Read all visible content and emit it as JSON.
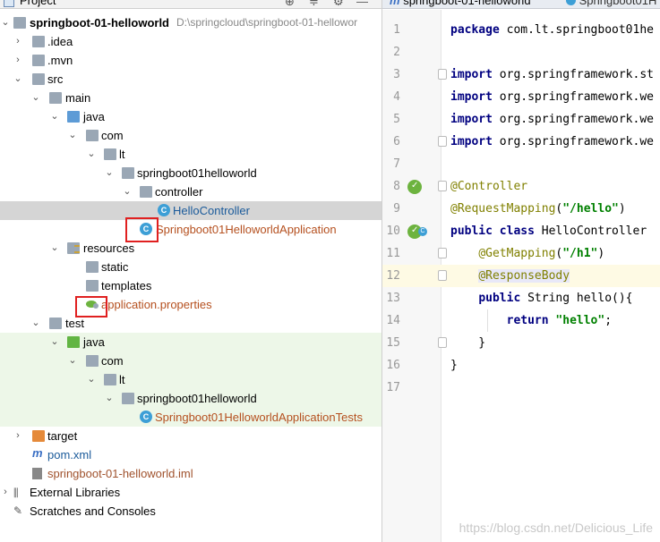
{
  "project_panel": {
    "title": "Project",
    "root": {
      "name": "springboot-01-helloworld",
      "path": "D:\\springcloud\\springboot-01-hellowor"
    },
    "nodes": {
      "idea": ".idea",
      "mvn": ".mvn",
      "src": "src",
      "main": "main",
      "java": "java",
      "com": "com",
      "lt": "lt",
      "pkg": "springboot01helloworld",
      "controller": "controller",
      "hello_controller": "HelloController",
      "app": "Springboot01HelloworldApplication",
      "resources": "resources",
      "static": "static",
      "templates": "templates",
      "app_props": "application.properties",
      "test": "test",
      "test_java": "java",
      "test_com": "com",
      "test_lt": "lt",
      "test_pkg": "springboot01helloworld",
      "app_tests": "Springboot01HelloworldApplicationTests",
      "target": "target",
      "pom": "pom.xml",
      "iml": "springboot-01-helloworld.iml",
      "ext_libs": "External Libraries",
      "scratches": "Scratches and Consoles"
    }
  },
  "editor": {
    "tabs": [
      {
        "label": "springboot-01-helloworld",
        "prefix": "m"
      },
      {
        "label": "Springboot01H"
      }
    ],
    "current_line": 12,
    "lines": [
      {
        "n": "1",
        "segs": [
          [
            "kw",
            "package "
          ],
          [
            "",
            "com.lt.springboot01he"
          ]
        ]
      },
      {
        "n": "2",
        "segs": []
      },
      {
        "n": "3",
        "segs": [
          [
            "kw",
            "import "
          ],
          [
            "",
            "org.springframework.st"
          ]
        ]
      },
      {
        "n": "4",
        "segs": [
          [
            "kw",
            "import "
          ],
          [
            "",
            "org.springframework.we"
          ]
        ]
      },
      {
        "n": "5",
        "segs": [
          [
            "kw",
            "import "
          ],
          [
            "",
            "org.springframework.we"
          ]
        ]
      },
      {
        "n": "6",
        "segs": [
          [
            "kw",
            "import "
          ],
          [
            "",
            "org.springframework.we"
          ]
        ]
      },
      {
        "n": "7",
        "segs": []
      },
      {
        "n": "8",
        "segs": [
          [
            "ann",
            "@Controller"
          ]
        ]
      },
      {
        "n": "9",
        "segs": [
          [
            "ann",
            "@RequestMapping"
          ],
          [
            "",
            "("
          ],
          [
            "str",
            "\"/hello\""
          ],
          [
            "",
            ")"
          ]
        ]
      },
      {
        "n": "10",
        "segs": [
          [
            "kw",
            "public class "
          ],
          [
            "",
            "HelloController"
          ]
        ]
      },
      {
        "n": "11",
        "segs": [
          [
            "",
            "    "
          ],
          [
            "ann",
            "@GetMapping"
          ],
          [
            "",
            "("
          ],
          [
            "str",
            "\"/h1\""
          ],
          [
            "",
            ")"
          ]
        ]
      },
      {
        "n": "12",
        "segs": [
          [
            "",
            "    "
          ],
          [
            "ann",
            "@ResponseBody"
          ]
        ]
      },
      {
        "n": "13",
        "segs": [
          [
            "",
            "    "
          ],
          [
            "kw",
            "public "
          ],
          [
            "",
            "String hello(){"
          ]
        ]
      },
      {
        "n": "14",
        "segs": [
          [
            "",
            "        "
          ],
          [
            "kw",
            "return "
          ],
          [
            "str",
            "\"hello\""
          ],
          [
            "",
            ";"
          ]
        ]
      },
      {
        "n": "15",
        "segs": [
          [
            "",
            "    }"
          ]
        ]
      },
      {
        "n": "16",
        "segs": [
          [
            "",
            "}"
          ]
        ]
      },
      {
        "n": "17",
        "segs": []
      }
    ]
  },
  "watermark": "https://blog.csdn.net/Delicious_Life",
  "colors": {
    "keyword": "#000080",
    "annotation": "#808000",
    "string": "#008000",
    "selection": "#d5d5d5",
    "test_bg": "#edf7e8",
    "highlight_box": "#e02020"
  }
}
